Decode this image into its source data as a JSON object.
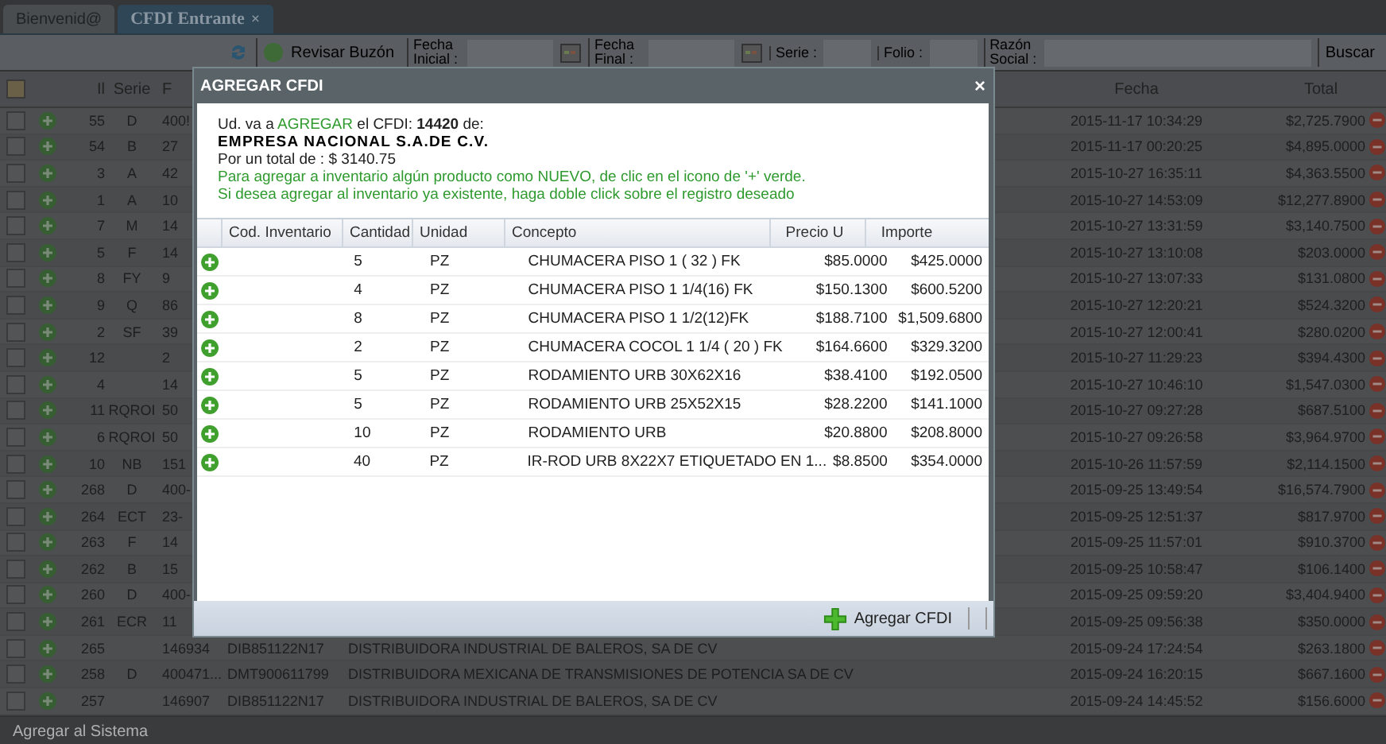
{
  "tabs": [
    {
      "label": "Bienvenid@",
      "selected": false,
      "closable": false
    },
    {
      "label": "CFDI Entrante",
      "selected": true,
      "closable": true
    }
  ],
  "close_tab_glyph": "×",
  "toolbar": {
    "check_button": "Revisar Buzón",
    "fecha_inicial": "Fecha Inicial :",
    "fecha_final": "Fecha Final :",
    "serie": "Serie :",
    "folio": "Folio :",
    "razon_social": "Razón Social :",
    "search_button": "Buscar"
  },
  "table": {
    "select_all_checked": false,
    "columns": [
      "Il",
      "Serie",
      "F",
      "Fecha",
      "Total"
    ],
    "rows": [
      {
        "checked": false,
        "id": "55",
        "serie": "D",
        "folio": "400!",
        "fecha": "2015-11-17 10:34:29",
        "total": "$2,725.7900"
      },
      {
        "checked": false,
        "id": "54",
        "serie": "B",
        "folio": "27",
        "fecha": "2015-11-17 00:20:25",
        "total": "$4,895.0000"
      },
      {
        "checked": false,
        "id": "3",
        "serie": "A",
        "folio": "42",
        "fecha": "2015-10-27 16:35:11",
        "total": "$4,363.5500"
      },
      {
        "checked": false,
        "id": "1",
        "serie": "A",
        "folio": "10",
        "fecha": "2015-10-27 14:53:09",
        "total": "$12,277.8900"
      },
      {
        "checked": false,
        "id": "7",
        "serie": "M",
        "folio": "14",
        "fecha": "2015-10-27 13:31:59",
        "total": "$3,140.7500"
      },
      {
        "checked": false,
        "id": "5",
        "serie": "F",
        "folio": "14",
        "fecha": "2015-10-27 13:10:08",
        "total": "$203.0000"
      },
      {
        "checked": false,
        "id": "8",
        "serie": "FY",
        "folio": "9",
        "fecha": "2015-10-27 13:07:33",
        "total": "$131.0800"
      },
      {
        "checked": false,
        "id": "9",
        "serie": "Q",
        "folio": "86",
        "fecha": "2015-10-27 12:20:21",
        "total": "$524.3200"
      },
      {
        "checked": false,
        "id": "2",
        "serie": "SF",
        "folio": "39",
        "fecha": "2015-10-27 12:00:41",
        "total": "$280.0200"
      },
      {
        "checked": false,
        "id": "12",
        "serie": "",
        "folio": "2",
        "fecha": "2015-10-27 11:29:23",
        "total": "$394.4300"
      },
      {
        "checked": false,
        "id": "4",
        "serie": "",
        "folio": "14",
        "fecha": "2015-10-27 10:46:10",
        "total": "$1,547.0300"
      },
      {
        "checked": false,
        "id": "11",
        "serie": "RQROI",
        "folio": "50",
        "fecha": "2015-10-27 09:27:28",
        "total": "$687.5100"
      },
      {
        "checked": false,
        "id": "6",
        "serie": "RQROI",
        "folio": "50",
        "fecha": "2015-10-27 09:26:58",
        "total": "$3,964.9700"
      },
      {
        "checked": false,
        "id": "10",
        "serie": "NB",
        "folio": "151",
        "fecha": "2015-10-26 11:57:59",
        "total": "$2,114.1500"
      },
      {
        "checked": false,
        "id": "268",
        "serie": "D",
        "folio": "400-",
        "fecha": "2015-09-25 13:49:54",
        "total": "$16,574.7900"
      },
      {
        "checked": false,
        "id": "264",
        "serie": "ECT",
        "folio": "23-",
        "fecha": "2015-09-25 12:51:37",
        "total": "$817.9700"
      },
      {
        "checked": false,
        "id": "263",
        "serie": "F",
        "folio": "14",
        "fecha": "2015-09-25 11:57:01",
        "total": "$910.3700"
      },
      {
        "checked": false,
        "id": "262",
        "serie": "B",
        "folio": "15",
        "fecha": "2015-09-25 10:58:47",
        "total": "$106.1400"
      },
      {
        "checked": false,
        "id": "260",
        "serie": "D",
        "folio": "400-",
        "fecha": "2015-09-25 09:59:20",
        "total": "$3,404.9400"
      },
      {
        "checked": false,
        "id": "261",
        "serie": "ECR",
        "folio": "11",
        "fecha": "2015-09-25 09:56:38",
        "total": "$350.0000"
      },
      {
        "checked": false,
        "id": "265",
        "serie": "",
        "folio": "146934",
        "rfc": "DIB851122N17",
        "razon": "DISTRIBUIDORA INDUSTRIAL DE BALEROS, SA DE CV",
        "fecha": "2015-09-24 17:24:54",
        "total": "$263.1800"
      },
      {
        "checked": false,
        "id": "258",
        "serie": "D",
        "folio": "400471...",
        "rfc": "DMT900611799",
        "razon": "DISTRIBUIDORA MEXICANA DE TRANSMISIONES DE POTENCIA SA DE CV",
        "fecha": "2015-09-24 16:20:15",
        "total": "$667.1600"
      },
      {
        "checked": false,
        "id": "257",
        "serie": "",
        "folio": "146907",
        "rfc": "DIB851122N17",
        "razon": "DISTRIBUIDORA INDUSTRIAL DE BALEROS, SA DE CV",
        "fecha": "2015-09-24 14:45:52",
        "total": "$156.6000"
      }
    ]
  },
  "status_bar": "Agregar al Sistema",
  "dialog": {
    "title": "AGREGAR CFDI",
    "close_glyph": "×",
    "intro": {
      "prefix": "Ud. va a",
      "action": "AGREGAR",
      "middle": "el CFDI:",
      "number": "14420",
      "suffix": "de:"
    },
    "company": "EMPRESA NACIONAL S.A.DE C.V.",
    "total_line": "Por un total de : $ 3140.75",
    "hints": [
      "Para agregar a inventario algún producto como NUEVO, de clic en el icono de '+' verde.",
      "Si desea agregar al inventario ya existente, haga doble click sobre el registro deseado"
    ],
    "columns": [
      "Cod. Inventario",
      "Cantidad",
      "Unidad",
      "Concepto",
      "Precio U",
      "Importe"
    ],
    "rows": [
      {
        "cantidad": "5",
        "unidad": "PZ",
        "concepto": "CHUMACERA PISO 1 ( 32 ) FK",
        "precio": "$85.0000",
        "importe": "$425.0000"
      },
      {
        "cantidad": "4",
        "unidad": "PZ",
        "concepto": "CHUMACERA PISO 1 1/4(16) FK",
        "precio": "$150.1300",
        "importe": "$600.5200"
      },
      {
        "cantidad": "8",
        "unidad": "PZ",
        "concepto": "CHUMACERA PISO 1 1/2(12)FK",
        "precio": "$188.7100",
        "importe": "$1,509.6800"
      },
      {
        "cantidad": "2",
        "unidad": "PZ",
        "concepto": "CHUMACERA COCOL 1 1/4 ( 20 ) FK",
        "precio": "$164.6600",
        "importe": "$329.3200"
      },
      {
        "cantidad": "5",
        "unidad": "PZ",
        "concepto": "RODAMIENTO URB 30X62X16",
        "precio": "$38.4100",
        "importe": "$192.0500"
      },
      {
        "cantidad": "5",
        "unidad": "PZ",
        "concepto": "RODAMIENTO URB 25X52X15",
        "precio": "$28.2200",
        "importe": "$141.1000"
      },
      {
        "cantidad": "10",
        "unidad": "PZ",
        "concepto": "RODAMIENTO URB",
        "precio": "$20.8800",
        "importe": "$208.8000"
      },
      {
        "cantidad": "40",
        "unidad": "PZ",
        "concepto": "IR-ROD URB 8X22X7 ETIQUETADO EN 1...",
        "precio": "$8.8500",
        "importe": "$354.0000"
      }
    ],
    "add_button": "Agregar CFDI"
  }
}
